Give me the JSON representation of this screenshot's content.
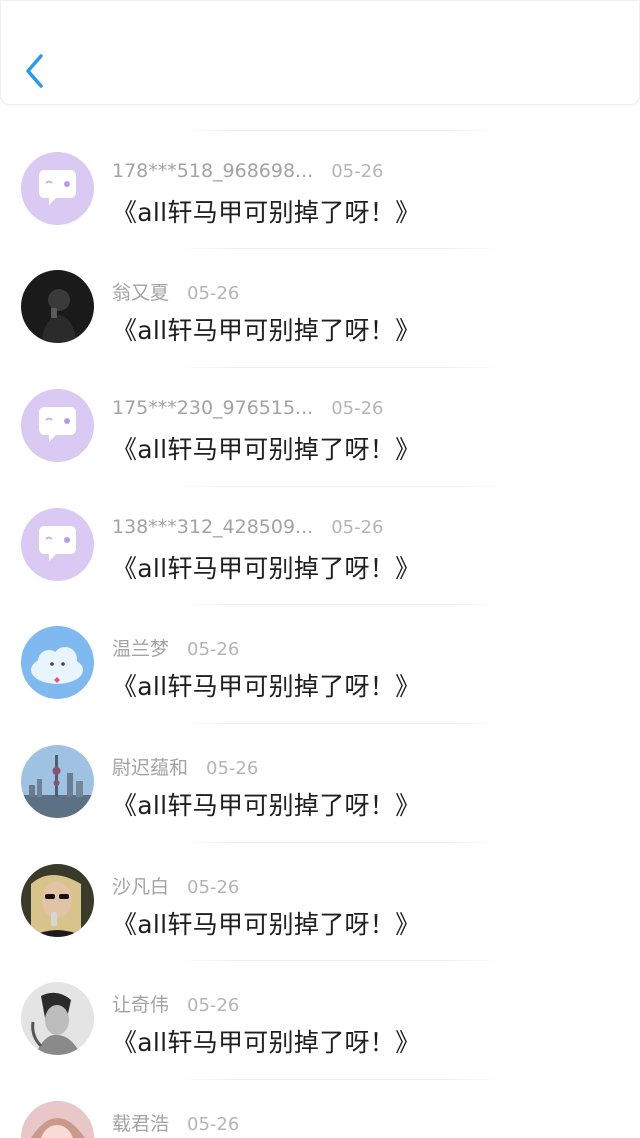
{
  "header": {
    "back_icon": "chevron-left-icon",
    "accent_color": "#2a9be8"
  },
  "comments": [
    {
      "name": "178***518_968698...",
      "date": "05-26",
      "text": "《all轩马甲可别掉了呀！》",
      "avatar": "default-chat-bubble"
    },
    {
      "name": "翁又夏",
      "date": "05-26",
      "text": "《all轩马甲可别掉了呀！》",
      "avatar": "photo-dark-portrait"
    },
    {
      "name": "175***230_976515...",
      "date": "05-26",
      "text": "《all轩马甲可别掉了呀！》",
      "avatar": "default-chat-bubble"
    },
    {
      "name": "138***312_428509...",
      "date": "05-26",
      "text": "《all轩马甲可别掉了呀！》",
      "avatar": "default-chat-bubble"
    },
    {
      "name": "温兰梦",
      "date": "05-26",
      "text": "《all轩马甲可别掉了呀！》",
      "avatar": "photo-cloud-sticker"
    },
    {
      "name": "尉迟蕴和",
      "date": "05-26",
      "text": "《all轩马甲可别掉了呀！》",
      "avatar": "photo-city-skyline"
    },
    {
      "name": "沙凡白",
      "date": "05-26",
      "text": "《all轩马甲可别掉了呀！》",
      "avatar": "photo-sunglasses-girl"
    },
    {
      "name": "让奇伟",
      "date": "05-26",
      "text": "《all轩马甲可别掉了呀！》",
      "avatar": "photo-bw-portrait"
    },
    {
      "name": "载君浩",
      "date": "05-26",
      "text": "",
      "avatar": "photo-anime-pink"
    }
  ]
}
